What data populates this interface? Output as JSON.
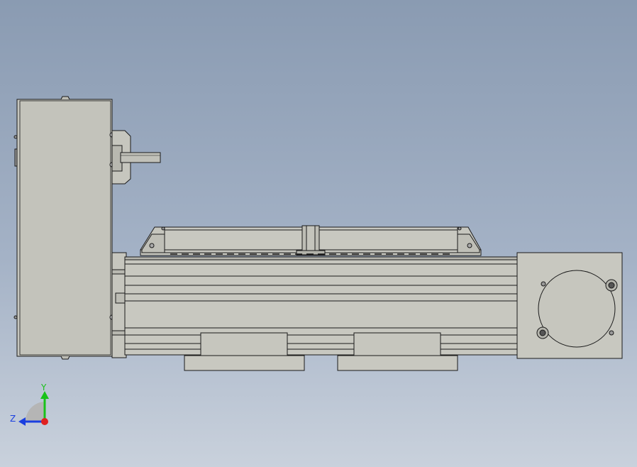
{
  "viewport": {
    "background_top": "#8a9bb2",
    "background_bottom": "#c9d1dc",
    "part_fill": "#c8c8c0",
    "part_stroke": "#1a1a1a"
  },
  "triad": {
    "y_label": "Y",
    "z_label": "Z",
    "y_color": "#19c219",
    "z_color": "#1a3fe0",
    "origin_color": "#e02020"
  }
}
